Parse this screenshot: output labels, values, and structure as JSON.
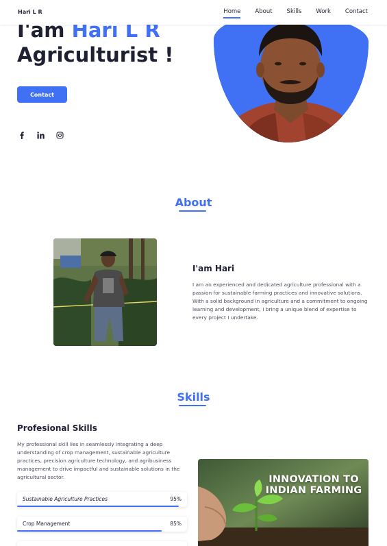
{
  "header": {
    "logo": "Hari L R",
    "nav": [
      "Home",
      "About",
      "Skills",
      "Work",
      "Contact"
    ]
  },
  "hero": {
    "greeting": "I'am",
    "name": "Hari L R",
    "role": "Agriculturist !",
    "button": "Contact",
    "socials": [
      "facebook-icon",
      "linkedin-icon",
      "instagram-icon"
    ]
  },
  "about": {
    "title": "About",
    "subtitle": "I'am Hari",
    "text": "I am an experienced and dedicated agriculture professional with a passion for sustainable farming practices and innovative solutions. With a solid background in agriculture and a commitment to ongoing learning and development, I bring a unique blend of expertise to every project I undertake."
  },
  "skills": {
    "title": "Skills",
    "subtitle": "Profesional Skills",
    "text": "My professional skill lies in seamlessly integrating a deep understanding of crop management, sustainable agriculture practices, precision agriculture technology, and agribusiness management to drive impactful and sustainable solutions in the agricultural sector.",
    "items": [
      {
        "name": "Sustainable Agriculture Practices",
        "percent": "95%",
        "level": 0.95
      },
      {
        "name": "Crop Management",
        "percent": "85%",
        "level": 0.85
      }
    ],
    "image_caption": "INNOVATION TO INDIAN FARMING"
  },
  "colors": {
    "accent": "#4070f4",
    "text": "#1f2133"
  }
}
